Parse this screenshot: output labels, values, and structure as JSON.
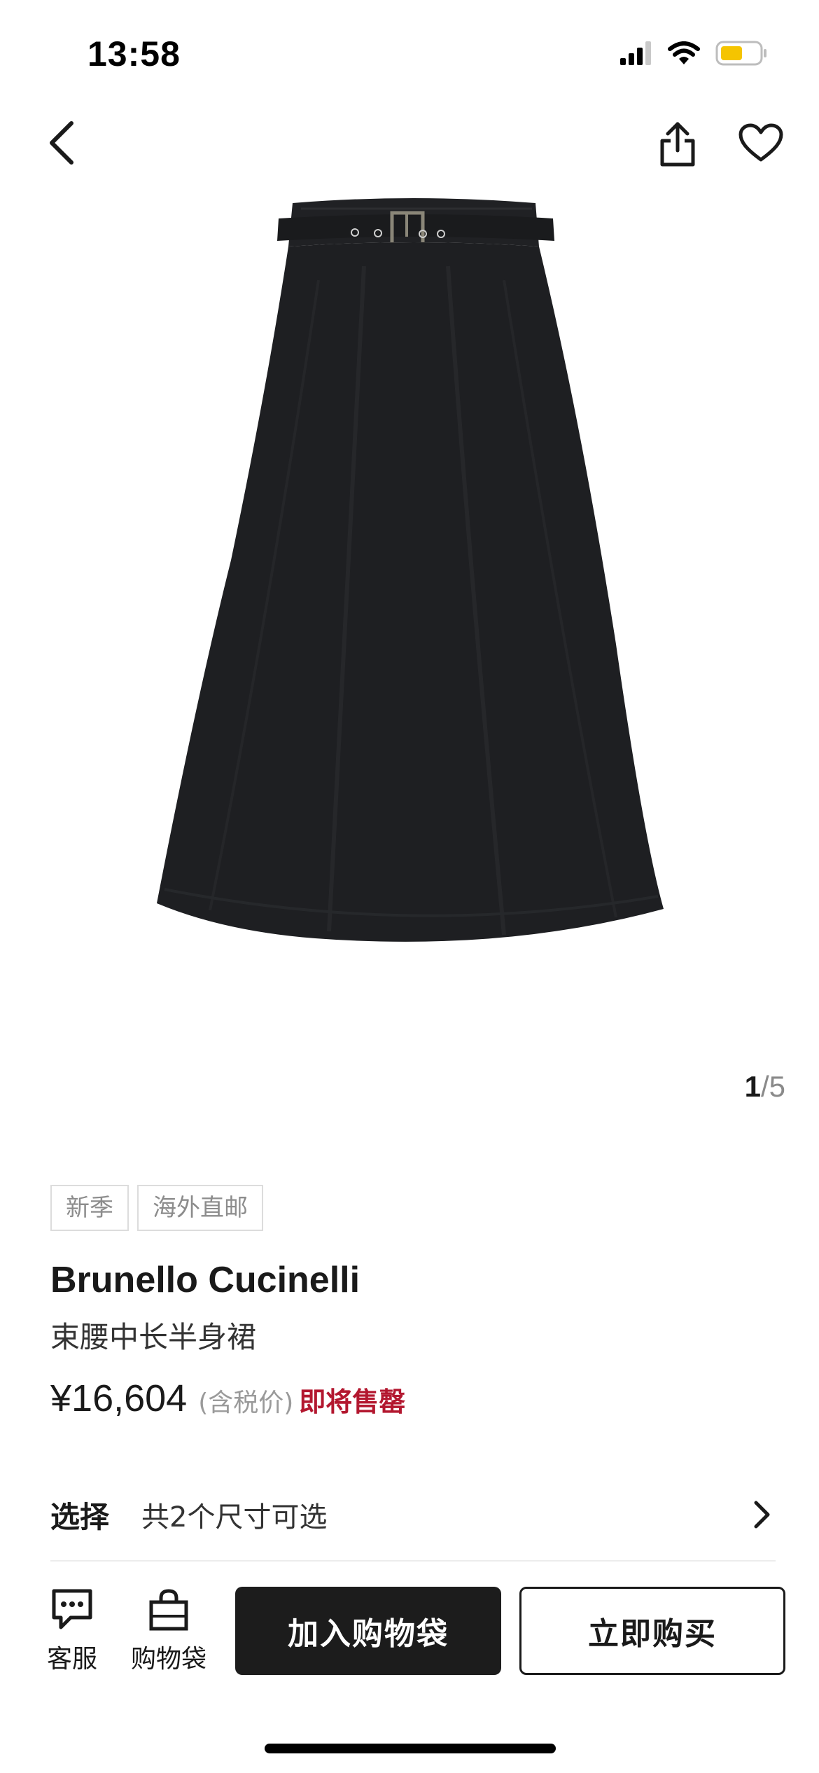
{
  "status_bar": {
    "time": "13:58",
    "icons": [
      "signal-icon",
      "wifi-icon",
      "battery-icon"
    ],
    "battery_color": "#f5c400"
  },
  "nav": {
    "back_icon": "chevron-left-icon",
    "share_icon": "share-icon",
    "favorite_icon": "heart-icon"
  },
  "gallery": {
    "current": "1",
    "separator": "/",
    "total": "5"
  },
  "product": {
    "tags": [
      "新季",
      "海外直邮"
    ],
    "brand": "Brunello Cucinelli",
    "name": "束腰中长半身裙",
    "price": "¥16,604",
    "tax_note": "(含税价)",
    "stock_status": "即将售罄",
    "stock_status_color": "#b3172f"
  },
  "size_selector": {
    "label": "选择",
    "value": "共2个尺寸可选"
  },
  "bottom_bar": {
    "service_label": "客服",
    "bag_label": "购物袋",
    "add_to_bag": "加入购物袋",
    "buy_now": "立即购买"
  }
}
